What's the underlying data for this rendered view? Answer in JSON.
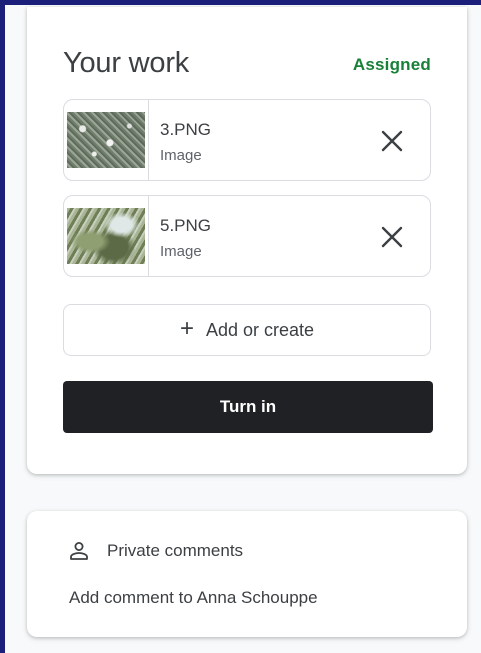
{
  "work": {
    "title": "Your work",
    "status": "Assigned",
    "attachments": [
      {
        "name": "3.PNG",
        "type": "Image",
        "icon": "close-icon"
      },
      {
        "name": "5.PNG",
        "type": "Image",
        "icon": "close-icon"
      }
    ],
    "add_label": "Add or create",
    "turn_in_label": "Turn in"
  },
  "comments": {
    "title": "Private comments",
    "placeholder": "Add comment to Anna Schouppe"
  },
  "colors": {
    "status_green": "#188038",
    "turn_in_bg": "#202124",
    "frame_border": "#1c1f7a"
  }
}
